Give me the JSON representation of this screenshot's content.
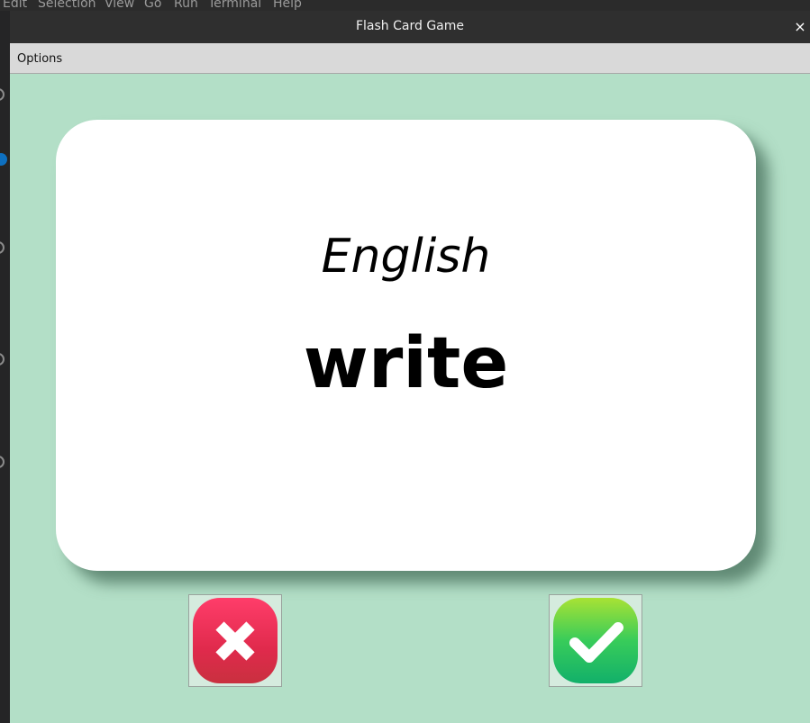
{
  "background_editor": {
    "menu": [
      "Edit",
      "Selection",
      "View",
      "Go",
      "Run",
      "Terminal",
      "Help"
    ]
  },
  "window": {
    "title": "Flash Card Game",
    "close_glyph": "×"
  },
  "menubar": {
    "options_label": "Options"
  },
  "card": {
    "language": "English",
    "word": "write",
    "background_color": "#ffffff"
  },
  "buttons": {
    "wrong_icon": "x-mark-icon",
    "right_icon": "check-mark-icon"
  },
  "colors": {
    "window_background": "#b3dfc7",
    "titlebar": "#2f2f2f",
    "wrong": "#e8305a",
    "right": "#2ec45e"
  }
}
